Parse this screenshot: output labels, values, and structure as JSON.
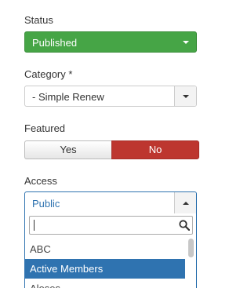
{
  "status": {
    "label": "Status",
    "value": "Published",
    "color": "#46a546"
  },
  "category": {
    "label": "Category *",
    "value": "- Simple Renew"
  },
  "featured": {
    "label": "Featured",
    "yes_label": "Yes",
    "no_label": "No",
    "selected": "No",
    "no_color": "#bd362f"
  },
  "access": {
    "label": "Access",
    "value": "Public",
    "accent_color": "#2f73b0",
    "search": {
      "value": "",
      "placeholder": ""
    },
    "options": [
      {
        "label": "ABC",
        "highlighted": false
      },
      {
        "label": "Active Members",
        "highlighted": true
      },
      {
        "label": "Aloses",
        "highlighted": false
      }
    ]
  }
}
